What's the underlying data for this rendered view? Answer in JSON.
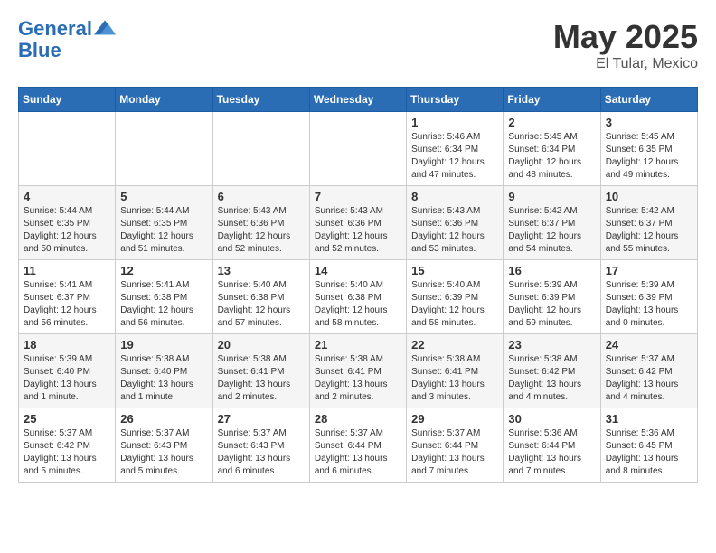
{
  "header": {
    "logo_line1": "General",
    "logo_line2": "Blue",
    "month": "May 2025",
    "location": "El Tular, Mexico"
  },
  "weekdays": [
    "Sunday",
    "Monday",
    "Tuesday",
    "Wednesday",
    "Thursday",
    "Friday",
    "Saturday"
  ],
  "weeks": [
    [
      {
        "day": "",
        "info": ""
      },
      {
        "day": "",
        "info": ""
      },
      {
        "day": "",
        "info": ""
      },
      {
        "day": "",
        "info": ""
      },
      {
        "day": "1",
        "info": "Sunrise: 5:46 AM\nSunset: 6:34 PM\nDaylight: 12 hours\nand 47 minutes."
      },
      {
        "day": "2",
        "info": "Sunrise: 5:45 AM\nSunset: 6:34 PM\nDaylight: 12 hours\nand 48 minutes."
      },
      {
        "day": "3",
        "info": "Sunrise: 5:45 AM\nSunset: 6:35 PM\nDaylight: 12 hours\nand 49 minutes."
      }
    ],
    [
      {
        "day": "4",
        "info": "Sunrise: 5:44 AM\nSunset: 6:35 PM\nDaylight: 12 hours\nand 50 minutes."
      },
      {
        "day": "5",
        "info": "Sunrise: 5:44 AM\nSunset: 6:35 PM\nDaylight: 12 hours\nand 51 minutes."
      },
      {
        "day": "6",
        "info": "Sunrise: 5:43 AM\nSunset: 6:36 PM\nDaylight: 12 hours\nand 52 minutes."
      },
      {
        "day": "7",
        "info": "Sunrise: 5:43 AM\nSunset: 6:36 PM\nDaylight: 12 hours\nand 52 minutes."
      },
      {
        "day": "8",
        "info": "Sunrise: 5:43 AM\nSunset: 6:36 PM\nDaylight: 12 hours\nand 53 minutes."
      },
      {
        "day": "9",
        "info": "Sunrise: 5:42 AM\nSunset: 6:37 PM\nDaylight: 12 hours\nand 54 minutes."
      },
      {
        "day": "10",
        "info": "Sunrise: 5:42 AM\nSunset: 6:37 PM\nDaylight: 12 hours\nand 55 minutes."
      }
    ],
    [
      {
        "day": "11",
        "info": "Sunrise: 5:41 AM\nSunset: 6:37 PM\nDaylight: 12 hours\nand 56 minutes."
      },
      {
        "day": "12",
        "info": "Sunrise: 5:41 AM\nSunset: 6:38 PM\nDaylight: 12 hours\nand 56 minutes."
      },
      {
        "day": "13",
        "info": "Sunrise: 5:40 AM\nSunset: 6:38 PM\nDaylight: 12 hours\nand 57 minutes."
      },
      {
        "day": "14",
        "info": "Sunrise: 5:40 AM\nSunset: 6:38 PM\nDaylight: 12 hours\nand 58 minutes."
      },
      {
        "day": "15",
        "info": "Sunrise: 5:40 AM\nSunset: 6:39 PM\nDaylight: 12 hours\nand 58 minutes."
      },
      {
        "day": "16",
        "info": "Sunrise: 5:39 AM\nSunset: 6:39 PM\nDaylight: 12 hours\nand 59 minutes."
      },
      {
        "day": "17",
        "info": "Sunrise: 5:39 AM\nSunset: 6:39 PM\nDaylight: 13 hours\nand 0 minutes."
      }
    ],
    [
      {
        "day": "18",
        "info": "Sunrise: 5:39 AM\nSunset: 6:40 PM\nDaylight: 13 hours\nand 1 minute."
      },
      {
        "day": "19",
        "info": "Sunrise: 5:38 AM\nSunset: 6:40 PM\nDaylight: 13 hours\nand 1 minute."
      },
      {
        "day": "20",
        "info": "Sunrise: 5:38 AM\nSunset: 6:41 PM\nDaylight: 13 hours\nand 2 minutes."
      },
      {
        "day": "21",
        "info": "Sunrise: 5:38 AM\nSunset: 6:41 PM\nDaylight: 13 hours\nand 2 minutes."
      },
      {
        "day": "22",
        "info": "Sunrise: 5:38 AM\nSunset: 6:41 PM\nDaylight: 13 hours\nand 3 minutes."
      },
      {
        "day": "23",
        "info": "Sunrise: 5:38 AM\nSunset: 6:42 PM\nDaylight: 13 hours\nand 4 minutes."
      },
      {
        "day": "24",
        "info": "Sunrise: 5:37 AM\nSunset: 6:42 PM\nDaylight: 13 hours\nand 4 minutes."
      }
    ],
    [
      {
        "day": "25",
        "info": "Sunrise: 5:37 AM\nSunset: 6:42 PM\nDaylight: 13 hours\nand 5 minutes."
      },
      {
        "day": "26",
        "info": "Sunrise: 5:37 AM\nSunset: 6:43 PM\nDaylight: 13 hours\nand 5 minutes."
      },
      {
        "day": "27",
        "info": "Sunrise: 5:37 AM\nSunset: 6:43 PM\nDaylight: 13 hours\nand 6 minutes."
      },
      {
        "day": "28",
        "info": "Sunrise: 5:37 AM\nSunset: 6:44 PM\nDaylight: 13 hours\nand 6 minutes."
      },
      {
        "day": "29",
        "info": "Sunrise: 5:37 AM\nSunset: 6:44 PM\nDaylight: 13 hours\nand 7 minutes."
      },
      {
        "day": "30",
        "info": "Sunrise: 5:36 AM\nSunset: 6:44 PM\nDaylight: 13 hours\nand 7 minutes."
      },
      {
        "day": "31",
        "info": "Sunrise: 5:36 AM\nSunset: 6:45 PM\nDaylight: 13 hours\nand 8 minutes."
      }
    ]
  ]
}
